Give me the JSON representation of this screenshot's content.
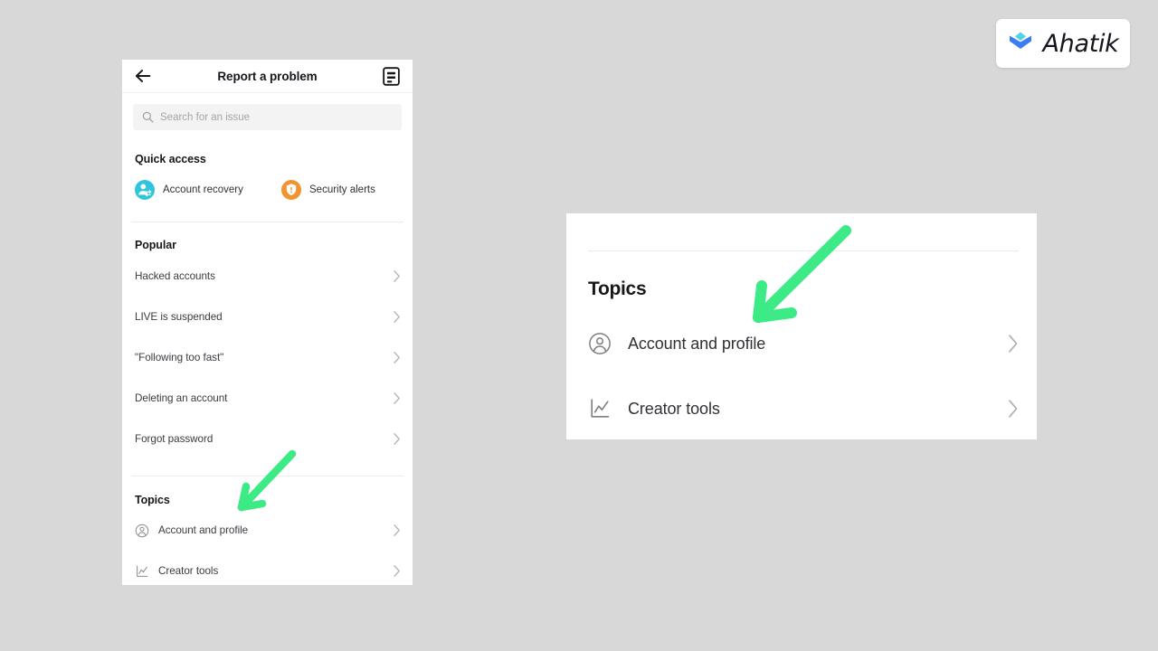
{
  "brand": {
    "name": "Ahatik",
    "logo_icon": "chevron-diamond-logo-icon",
    "logo_top_color": "#4fd3e8",
    "logo_bottom_color": "#3b7cf0"
  },
  "annotations": {
    "arrow_color": "#3ceb85",
    "arrows": [
      {
        "name": "arrow-pointing-account-and-profile-phone",
        "direction": "down-left"
      },
      {
        "name": "arrow-pointing-account-and-profile-callout",
        "direction": "down-left"
      }
    ]
  },
  "phone": {
    "header": {
      "back_icon": "back-arrow-icon",
      "title": "Report a problem",
      "reports_icon": "document-list-icon"
    },
    "search": {
      "icon": "search-icon",
      "placeholder": "Search for an issue",
      "value": ""
    },
    "quick_access": {
      "title": "Quick access",
      "items": [
        {
          "label": "Account recovery",
          "icon": "account-recovery-icon",
          "color": "#2fc6dd"
        },
        {
          "label": "Security alerts",
          "icon": "shield-alert-icon",
          "color": "#f2932f"
        }
      ]
    },
    "popular": {
      "title": "Popular",
      "items": [
        {
          "label": "Hacked accounts"
        },
        {
          "label": "LIVE is suspended"
        },
        {
          "label": "\"Following too fast\""
        },
        {
          "label": "Deleting an account"
        },
        {
          "label": "Forgot password"
        }
      ]
    },
    "topics": {
      "title": "Topics",
      "items": [
        {
          "label": "Account and profile",
          "icon": "account-circle-icon"
        },
        {
          "label": "Creator tools",
          "icon": "line-chart-icon"
        }
      ]
    }
  },
  "callout": {
    "title": "Topics",
    "items": [
      {
        "label": "Account and profile",
        "icon": "account-circle-icon"
      },
      {
        "label": "Creator tools",
        "icon": "line-chart-icon"
      }
    ]
  }
}
